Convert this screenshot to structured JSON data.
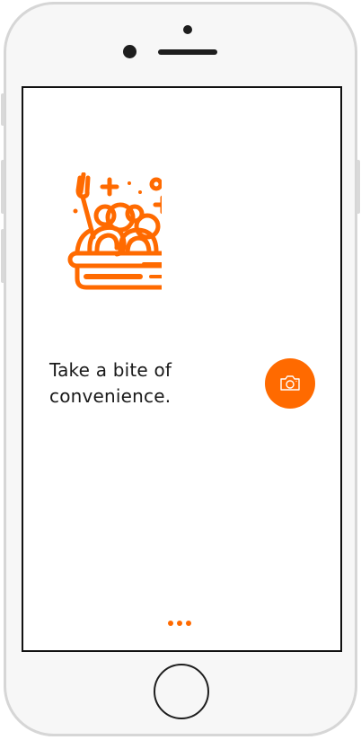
{
  "app": {
    "accent_color": "#ff6a00"
  },
  "onboarding": {
    "illustration_icon": "pasta-bowl-icon",
    "tagline": "Take a bite of\nconvenience.",
    "camera_button_icon": "camera-icon",
    "page_indicator": {
      "total_pages": 3
    }
  }
}
